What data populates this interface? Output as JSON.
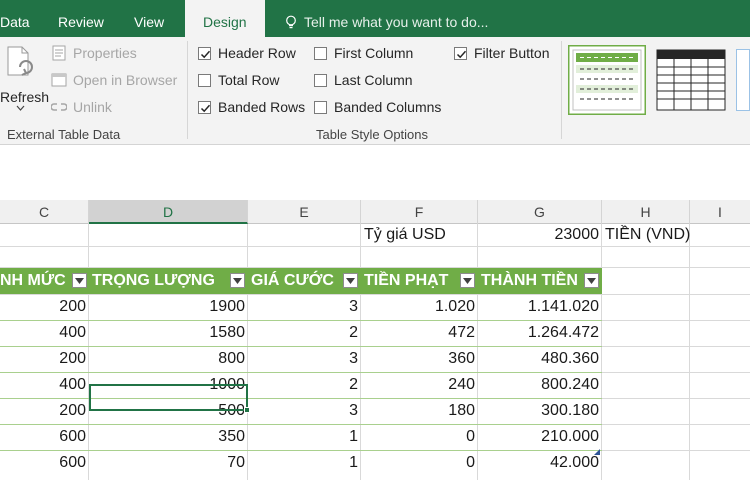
{
  "ribbon_tabs": {
    "data": "Data",
    "review": "Review",
    "view": "View",
    "design": "Design"
  },
  "tell_me": {
    "placeholder": "Tell me what you want to do..."
  },
  "external_table_data": {
    "refresh": "Refresh",
    "properties": "Properties",
    "open_in_browser": "Open in Browser",
    "unlink": "Unlink",
    "group_label": "External Table Data"
  },
  "table_style_options": {
    "header_row": {
      "label": "Header Row",
      "checked": true
    },
    "total_row": {
      "label": "Total Row",
      "checked": false
    },
    "banded_rows": {
      "label": "Banded Rows",
      "checked": true
    },
    "first_column": {
      "label": "First Column",
      "checked": false
    },
    "last_column": {
      "label": "Last Column",
      "checked": false
    },
    "banded_columns": {
      "label": "Banded Columns",
      "checked": false
    },
    "filter_button": {
      "label": "Filter Button",
      "checked": true
    },
    "group_label": "Table Style Options"
  },
  "colors": {
    "accent": "#217346",
    "table_header": "#70ad47",
    "band_line": "#a9d08e"
  },
  "sheet": {
    "columns": [
      "C",
      "D",
      "E",
      "F",
      "G",
      "H",
      "I"
    ],
    "selected_column": "D",
    "exchange_rate_label": "Tỷ giá USD",
    "exchange_rate_value": "23000",
    "vnd_label": "TIỀN (VND)",
    "table_headers": [
      "NH MỨC",
      "TRỌNG LƯỢNG",
      "GIÁ CƯỚC",
      "TIỀN PHẠT",
      "THÀNH TIỀN"
    ],
    "rows": [
      [
        "200",
        "1900",
        "3",
        "1.020",
        "1.141.020"
      ],
      [
        "400",
        "1580",
        "2",
        "472",
        "1.264.472"
      ],
      [
        "200",
        "800",
        "3",
        "360",
        "480.360"
      ],
      [
        "400",
        "1000",
        "2",
        "240",
        "800.240"
      ],
      [
        "200",
        "500",
        "3",
        "180",
        "300.180"
      ],
      [
        "600",
        "350",
        "1",
        "0",
        "210.000"
      ],
      [
        "600",
        "70",
        "1",
        "0",
        "42.000"
      ]
    ],
    "active_cell": "D row 5"
  }
}
